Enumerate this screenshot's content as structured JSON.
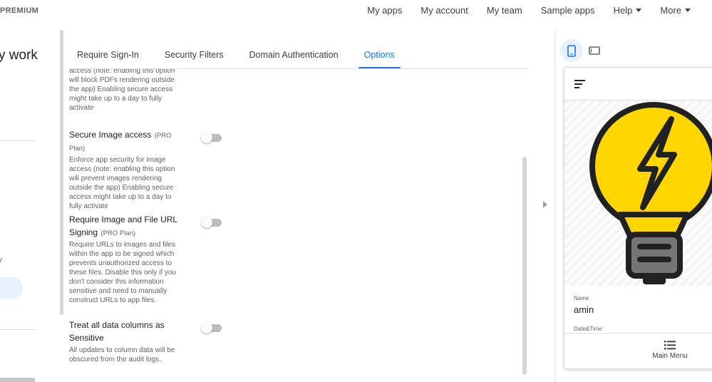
{
  "header": {
    "brand": "PREMIUM",
    "nav": [
      {
        "label": "My apps"
      },
      {
        "label": "My account"
      },
      {
        "label": "My team"
      },
      {
        "label": "Sample apps"
      },
      {
        "label": "Help"
      },
      {
        "label": "More"
      }
    ]
  },
  "left_panel": {
    "title_fragment": "y work",
    "tiny_text": "y"
  },
  "tabs": [
    {
      "label": "Require Sign-In"
    },
    {
      "label": "Security Filters"
    },
    {
      "label": "Domain Authentication"
    },
    {
      "label": "Options"
    }
  ],
  "settings": [
    {
      "title": "",
      "plan": "",
      "desc": "access (note: enabling this option will block PDFs rendering outside the app) Enabling secure access might take up to a day to fully activate"
    },
    {
      "title": "Secure Image access",
      "plan": "(PRO Plan)",
      "desc": "Enforce app security for image access (note: enabling this option will prevent images rendering outside the app) Enabling secure access might take up to a day to fully activate",
      "enabled": false
    },
    {
      "title": "Require Image and File URL Signing",
      "plan": "(PRO Plan)",
      "desc": "Require URLs to images and files within the app to be signed which prevents unauthorized access to these files. Disable this only if you don't consider this information sensitive and need to manually construct URLs to app files.",
      "enabled": false
    },
    {
      "title": "Treat all data columns as Sensitive",
      "plan": "",
      "desc": "All updates to column data will be obscured from the audit logs.",
      "enabled": false
    }
  ],
  "preview": {
    "mode": "mobile",
    "fields": [
      {
        "label": "Name",
        "value": "amin"
      },
      {
        "label": "Date&Time",
        "value": ""
      }
    ],
    "footer_menu_label": "Main Menu"
  },
  "colors": {
    "accent": "#1a73e8",
    "bulb_yellow": "#ffd600",
    "icon_dark": "#212121"
  }
}
